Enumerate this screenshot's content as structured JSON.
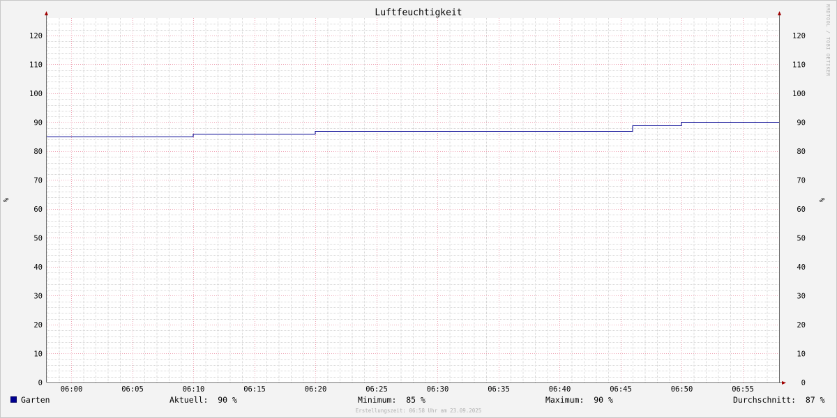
{
  "chart_data": {
    "type": "line",
    "title": "Luftfeuchtigkeit",
    "ylabel": "%",
    "xlabel": "",
    "ylim": [
      0,
      126
    ],
    "y_ticks": [
      0,
      10,
      20,
      30,
      40,
      50,
      60,
      70,
      80,
      90,
      100,
      110,
      120
    ],
    "x_ticks": [
      "06:00",
      "06:05",
      "06:10",
      "06:15",
      "06:20",
      "06:25",
      "06:30",
      "06:35",
      "06:40",
      "06:45",
      "06:50",
      "06:55"
    ],
    "grid": true,
    "series": [
      {
        "name": "Garten",
        "color": "#000090",
        "step": true,
        "points": [
          [
            "05:58",
            85
          ],
          [
            "06:10",
            86
          ],
          [
            "06:20",
            87
          ],
          [
            "06:46",
            89
          ],
          [
            "06:50",
            90
          ],
          [
            "06:58",
            90
          ]
        ]
      }
    ]
  },
  "legend": {
    "series_name": "Garten",
    "current": "Aktuell:  90 %",
    "minimum": "Minimum:  85 %",
    "maximum": "Maximum:  90 %",
    "average": "Durchschnitt:  87 %"
  },
  "watermark": "RRDTOOL / TOBI OETIKER",
  "footer": "Erstellungszeit: 06:58 Uhr am 23.09.2025"
}
